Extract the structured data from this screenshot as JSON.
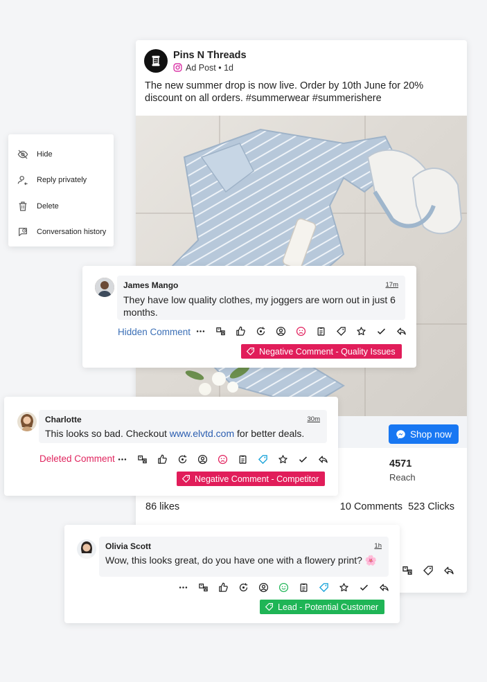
{
  "post": {
    "brand_name": "Pins N Threads",
    "meta": "Ad Post • 1d",
    "text": "The new summer drop is now live. Order by 10th June for 20% discount on all orders. #summerwear #summerishere",
    "shop_button": "Shop now",
    "reach_value": "4571",
    "reach_label": "Reach",
    "likes": "86 likes",
    "counts": "10 Comments  523 Clicks"
  },
  "menu": {
    "items": [
      {
        "label": "Hide",
        "icon": "eye-off-icon"
      },
      {
        "label": "Reply privately",
        "icon": "user-reply-icon"
      },
      {
        "label": "Delete",
        "icon": "trash-icon"
      },
      {
        "label": "Conversation history",
        "icon": "chat-history-icon"
      }
    ]
  },
  "comments": [
    {
      "name": "James Mango",
      "time": "17m",
      "text": "They have low quality clothes, my joggers are worn out in just 6 months.",
      "status": "Hidden Comment",
      "tag": "Negative Comment - Quality Issues",
      "sentiment": "negative"
    },
    {
      "name": "Charlotte",
      "time": "30m",
      "text_before": "This looks so bad. Checkout ",
      "link": "www.elvtd.com",
      "text_after": " for better deals.",
      "status": "Deleted Comment",
      "tag": "Negative Comment - Competitor",
      "sentiment": "negative"
    },
    {
      "name": "Olivia Scott",
      "time": "1h",
      "text": "Wow, this looks great, do you have one with a flowery print? 🌸",
      "tag": "Lead - Potential Customer",
      "sentiment": "positive"
    }
  ],
  "colors": {
    "accent_blue": "#1877f2",
    "negative_tag": "#e11d5a",
    "lead_tag": "#1fb556",
    "hidden_status": "#3b6fb6",
    "deleted_status": "#e0245e"
  }
}
